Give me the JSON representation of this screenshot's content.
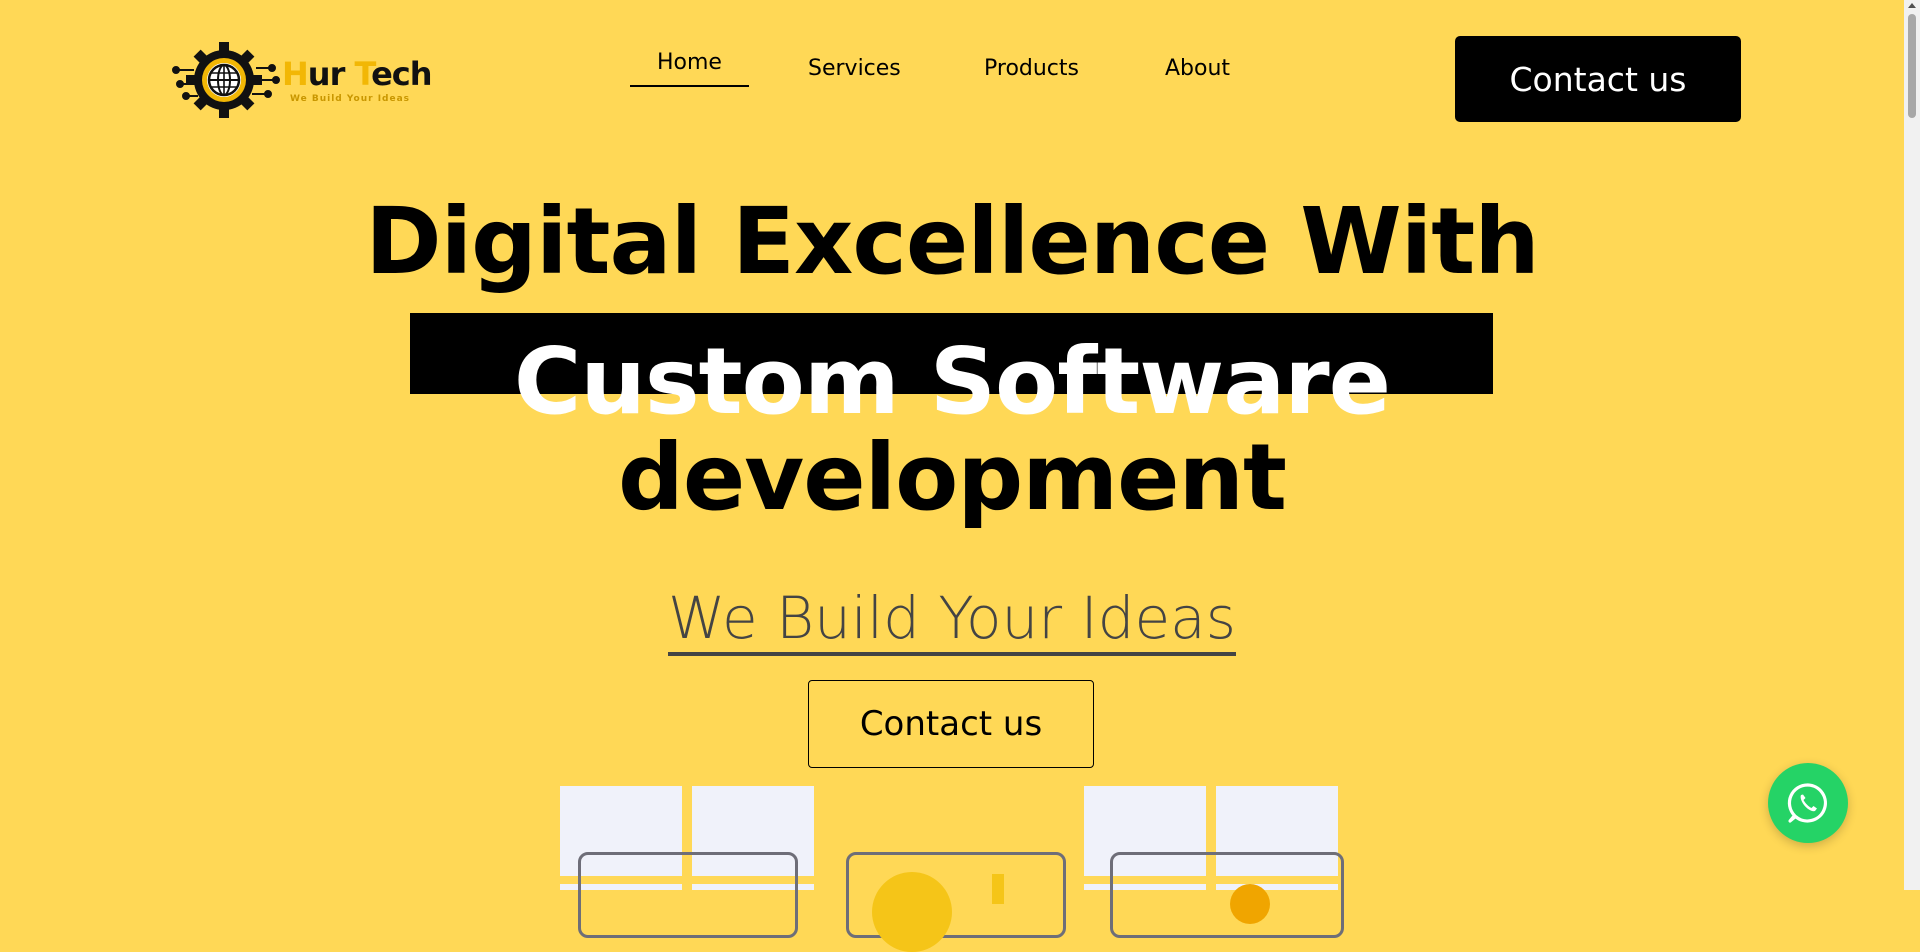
{
  "brand": {
    "name_part1": "H",
    "name_part2": "ur ",
    "name_part3": "T",
    "name_part4": "ech",
    "tagline": "We Build Your Ideas"
  },
  "nav": {
    "items": [
      {
        "label": "Home",
        "active": true
      },
      {
        "label": "Services"
      },
      {
        "label": "Products"
      },
      {
        "label": "About"
      }
    ],
    "cta_label": "Contact us"
  },
  "hero": {
    "line1": "Digital Excellence With",
    "line2": "Custom Software",
    "line3": "development",
    "tagline": "We Build Your Ideas",
    "cta_label": "Contact us"
  },
  "icons": {
    "whatsapp": "whatsapp-icon",
    "logo": "gear-globe-logo-icon"
  },
  "colors": {
    "background": "#ffd856",
    "accent": "#000000",
    "whatsapp": "#25d366",
    "logo_accent": "#f2b705"
  }
}
